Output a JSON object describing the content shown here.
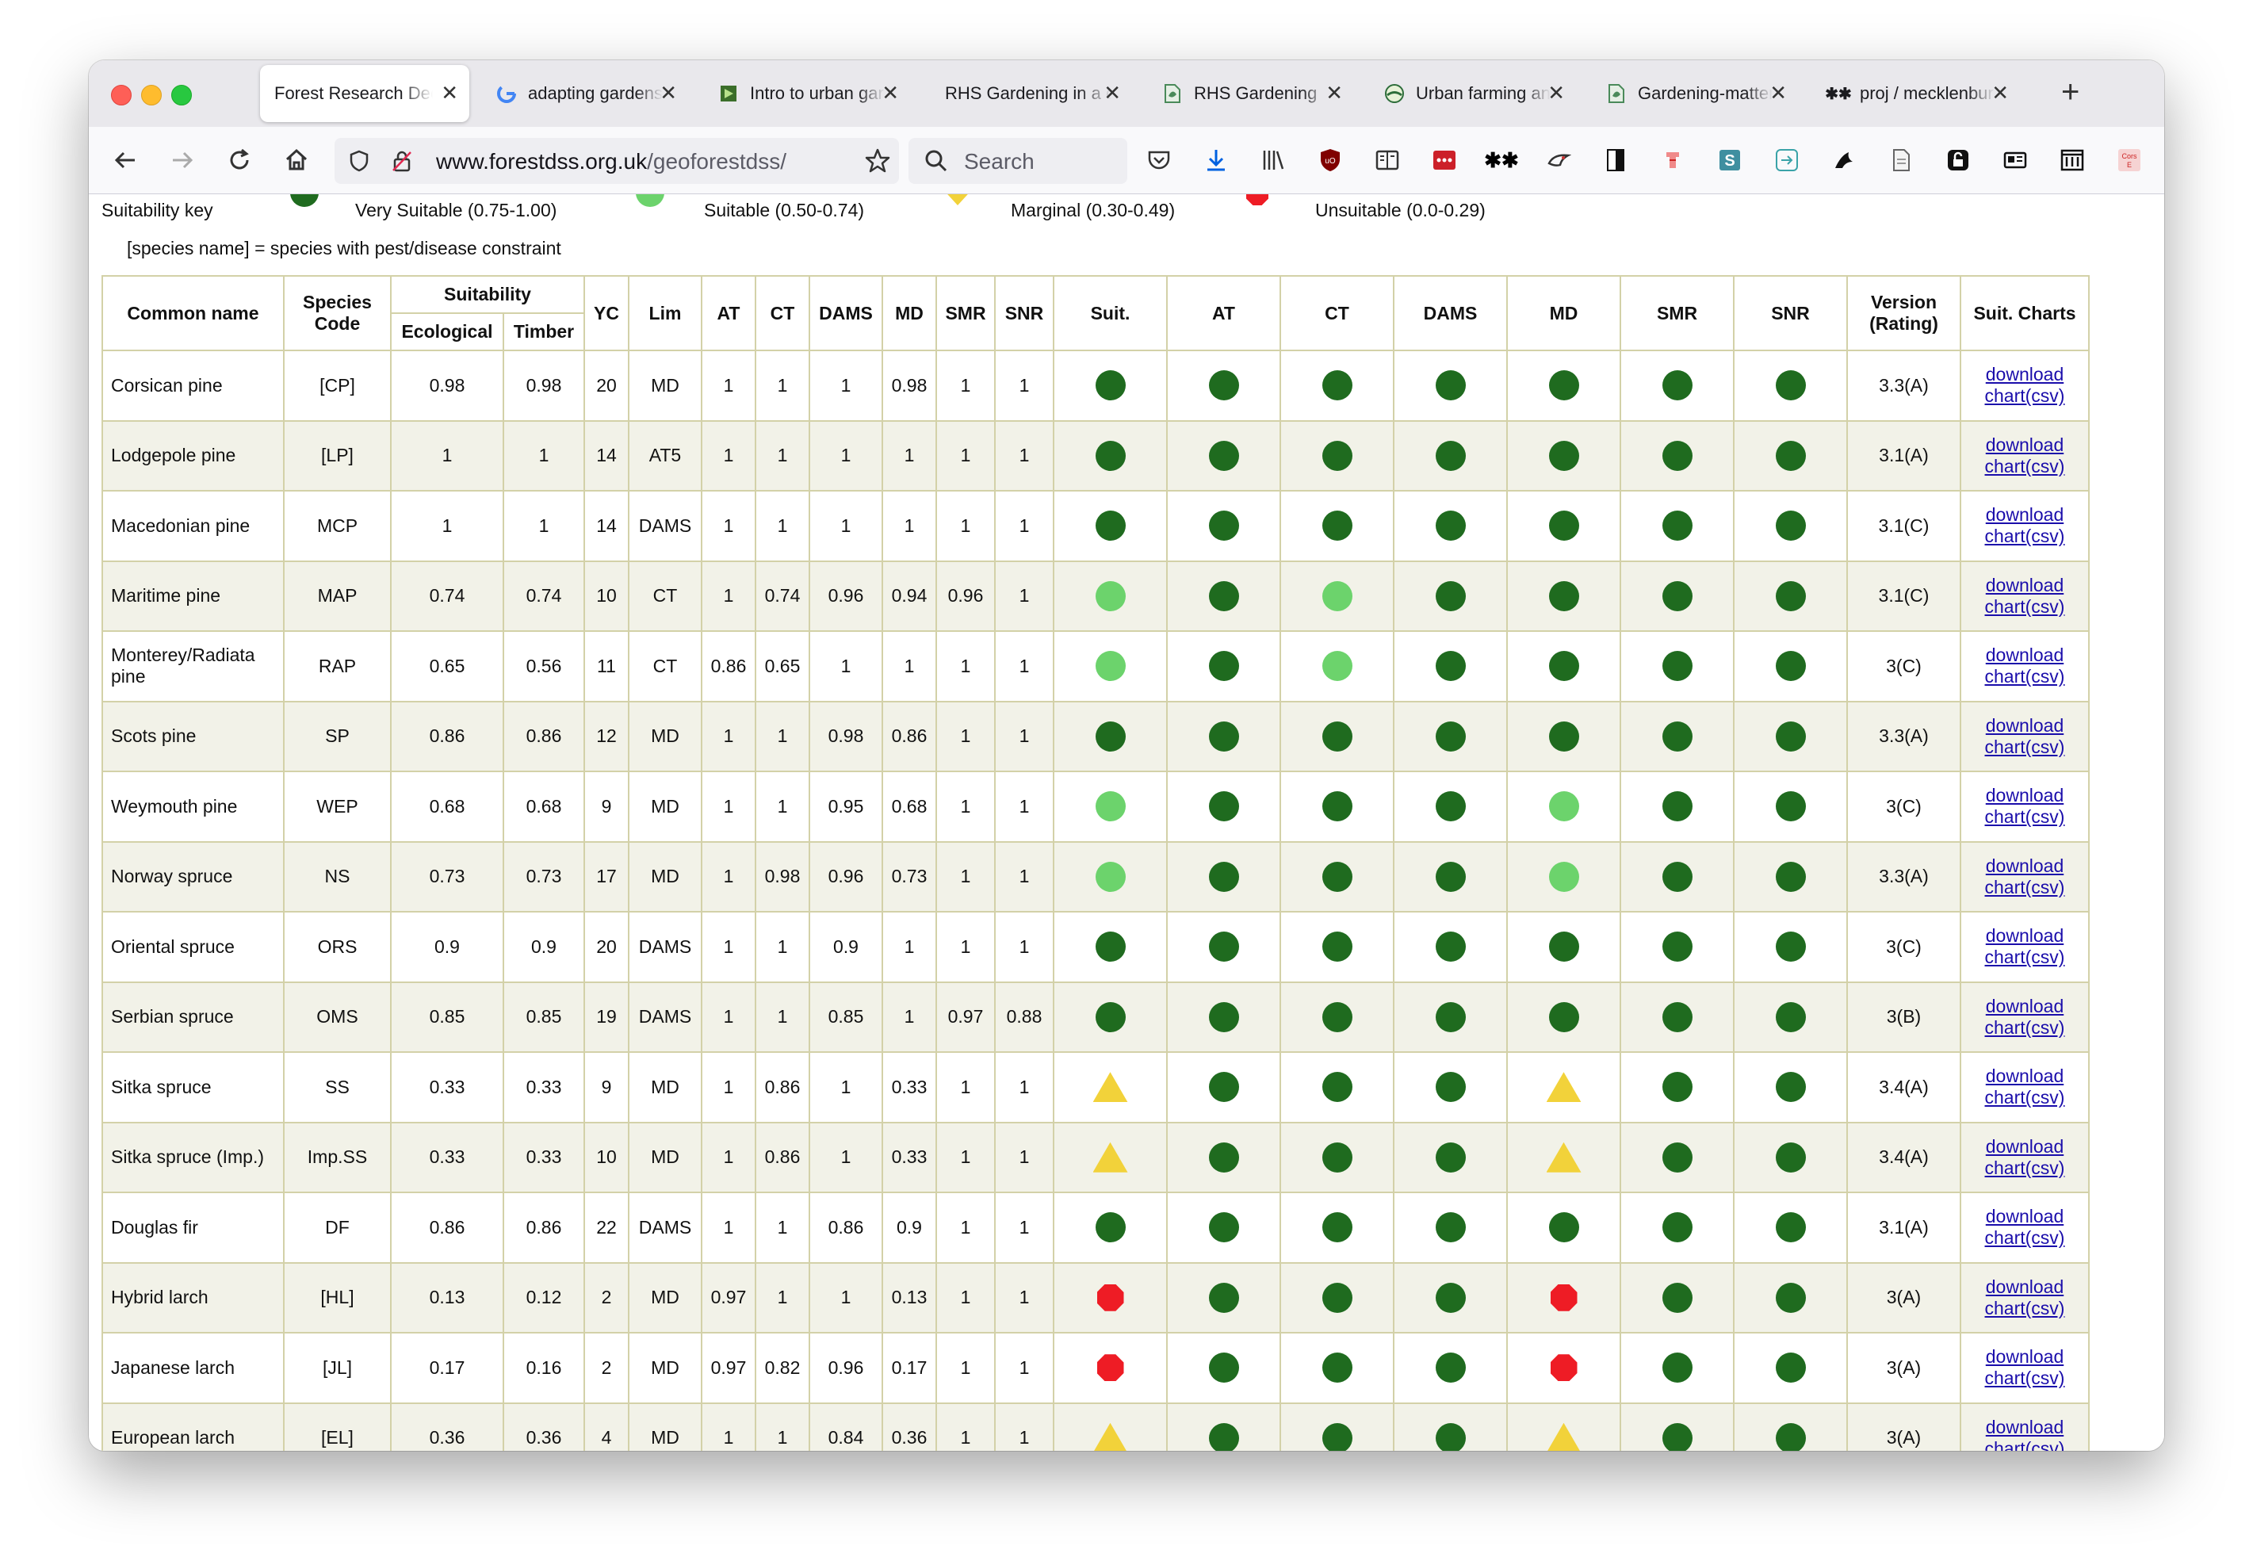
{
  "browser": {
    "tabs": [
      {
        "title": "Forest Research Decision Support",
        "icon": "forest-research-icon",
        "active": true
      },
      {
        "title": "adapting gardens",
        "icon": "google-icon"
      },
      {
        "title": "Intro to urban gardening",
        "icon": "bookmark-flag-icon"
      },
      {
        "title": "RHS Gardening in a changing climate",
        "icon": "none"
      },
      {
        "title": "RHS Gardening",
        "icon": "doc-leaf-icon"
      },
      {
        "title": "Urban farming and",
        "icon": "globe-leaf-icon"
      },
      {
        "title": "Gardening-matters",
        "icon": "doc-leaf-icon"
      },
      {
        "title": "proj / mecklenburg",
        "icon": "asterisk-icon"
      }
    ],
    "url_host": "www.forestdss.org.uk",
    "url_path": "/geoforestdss/",
    "search_placeholder": "Search"
  },
  "page": {
    "key_label": "Suitability key",
    "key_very_suitable": "Very Suitable (0.75-1.00)",
    "key_suitable": "Suitable (0.50-0.74)",
    "key_marginal": "Marginal (0.30-0.49)",
    "key_unsuitable": "Unsuitable (0.0-0.29)",
    "constraint_note": "[species name] = species with pest/disease constraint",
    "headers": {
      "common_name": "Common name",
      "species_code": "Species Code",
      "suitability": "Suitability",
      "ecological": "Ecological",
      "timber": "Timber",
      "yc": "YC",
      "lim": "Lim",
      "at": "AT",
      "ct": "CT",
      "dams": "DAMS",
      "md": "MD",
      "smr": "SMR",
      "snr": "SNR",
      "suit": "Suit.",
      "at2": "AT",
      "ct2": "CT",
      "dams2": "DAMS",
      "md2": "MD",
      "smr2": "SMR",
      "snr2": "SNR",
      "version": "Version (Rating)",
      "suit_charts": "Suit. Charts"
    },
    "download_label": "download",
    "chart_csv_label": "chart(csv)",
    "colors": {
      "very_suitable": "#1f6b1f",
      "suitable": "#6cd36c",
      "marginal": "#f2d23a",
      "unsuitable": "#ee1c25",
      "grid": "#d3d1a8",
      "alt_row": "#f2f2e8",
      "link": "#1a0dab"
    },
    "rows": [
      {
        "name": "Corsican pine",
        "code": "[CP]",
        "eco": "0.98",
        "timber": "0.98",
        "yc": "20",
        "lim": "MD",
        "at": "1",
        "ct": "1",
        "dams": "1",
        "md": "0.98",
        "smr": "1",
        "snr": "1",
        "version": "3.3(A)",
        "icons": [
          "vs",
          "vs",
          "vs",
          "vs",
          "vs",
          "vs",
          "vs"
        ]
      },
      {
        "name": "Lodgepole pine",
        "code": "[LP]",
        "eco": "1",
        "timber": "1",
        "yc": "14",
        "lim": "AT5",
        "at": "1",
        "ct": "1",
        "dams": "1",
        "md": "1",
        "smr": "1",
        "snr": "1",
        "version": "3.1(A)",
        "icons": [
          "vs",
          "vs",
          "vs",
          "vs",
          "vs",
          "vs",
          "vs"
        ]
      },
      {
        "name": "Macedonian pine",
        "code": "MCP",
        "eco": "1",
        "timber": "1",
        "yc": "14",
        "lim": "DAMS",
        "at": "1",
        "ct": "1",
        "dams": "1",
        "md": "1",
        "smr": "1",
        "snr": "1",
        "version": "3.1(C)",
        "icons": [
          "vs",
          "vs",
          "vs",
          "vs",
          "vs",
          "vs",
          "vs"
        ]
      },
      {
        "name": "Maritime pine",
        "code": "MAP",
        "eco": "0.74",
        "timber": "0.74",
        "yc": "10",
        "lim": "CT",
        "at": "1",
        "ct": "0.74",
        "dams": "0.96",
        "md": "0.94",
        "smr": "0.96",
        "snr": "1",
        "version": "3.1(C)",
        "icons": [
          "s",
          "vs",
          "s",
          "vs",
          "vs",
          "vs",
          "vs"
        ]
      },
      {
        "name": "Monterey/Radiata pine",
        "code": "RAP",
        "eco": "0.65",
        "timber": "0.56",
        "yc": "11",
        "lim": "CT",
        "at": "0.86",
        "ct": "0.65",
        "dams": "1",
        "md": "1",
        "smr": "1",
        "snr": "1",
        "version": "3(C)",
        "icons": [
          "s",
          "vs",
          "s",
          "vs",
          "vs",
          "vs",
          "vs"
        ]
      },
      {
        "name": "Scots pine",
        "code": "SP",
        "eco": "0.86",
        "timber": "0.86",
        "yc": "12",
        "lim": "MD",
        "at": "1",
        "ct": "1",
        "dams": "0.98",
        "md": "0.86",
        "smr": "1",
        "snr": "1",
        "version": "3.3(A)",
        "icons": [
          "vs",
          "vs",
          "vs",
          "vs",
          "vs",
          "vs",
          "vs"
        ]
      },
      {
        "name": "Weymouth pine",
        "code": "WEP",
        "eco": "0.68",
        "timber": "0.68",
        "yc": "9",
        "lim": "MD",
        "at": "1",
        "ct": "1",
        "dams": "0.95",
        "md": "0.68",
        "smr": "1",
        "snr": "1",
        "version": "3(C)",
        "icons": [
          "s",
          "vs",
          "vs",
          "vs",
          "s",
          "vs",
          "vs"
        ]
      },
      {
        "name": "Norway spruce",
        "code": "NS",
        "eco": "0.73",
        "timber": "0.73",
        "yc": "17",
        "lim": "MD",
        "at": "1",
        "ct": "0.98",
        "dams": "0.96",
        "md": "0.73",
        "smr": "1",
        "snr": "1",
        "version": "3.3(A)",
        "icons": [
          "s",
          "vs",
          "vs",
          "vs",
          "s",
          "vs",
          "vs"
        ]
      },
      {
        "name": "Oriental spruce",
        "code": "ORS",
        "eco": "0.9",
        "timber": "0.9",
        "yc": "20",
        "lim": "DAMS",
        "at": "1",
        "ct": "1",
        "dams": "0.9",
        "md": "1",
        "smr": "1",
        "snr": "1",
        "version": "3(C)",
        "icons": [
          "vs",
          "vs",
          "vs",
          "vs",
          "vs",
          "vs",
          "vs"
        ]
      },
      {
        "name": "Serbian spruce",
        "code": "OMS",
        "eco": "0.85",
        "timber": "0.85",
        "yc": "19",
        "lim": "DAMS",
        "at": "1",
        "ct": "1",
        "dams": "0.85",
        "md": "1",
        "smr": "0.97",
        "snr": "0.88",
        "version": "3(B)",
        "icons": [
          "vs",
          "vs",
          "vs",
          "vs",
          "vs",
          "vs",
          "vs"
        ]
      },
      {
        "name": "Sitka spruce",
        "code": "SS",
        "eco": "0.33",
        "timber": "0.33",
        "yc": "9",
        "lim": "MD",
        "at": "1",
        "ct": "0.86",
        "dams": "1",
        "md": "0.33",
        "smr": "1",
        "snr": "1",
        "version": "3.4(A)",
        "icons": [
          "m",
          "vs",
          "vs",
          "vs",
          "m",
          "vs",
          "vs"
        ]
      },
      {
        "name": "Sitka spruce (Imp.)",
        "code": "Imp.SS",
        "eco": "0.33",
        "timber": "0.33",
        "yc": "10",
        "lim": "MD",
        "at": "1",
        "ct": "0.86",
        "dams": "1",
        "md": "0.33",
        "smr": "1",
        "snr": "1",
        "version": "3.4(A)",
        "icons": [
          "m",
          "vs",
          "vs",
          "vs",
          "m",
          "vs",
          "vs"
        ]
      },
      {
        "name": "Douglas fir",
        "code": "DF",
        "eco": "0.86",
        "timber": "0.86",
        "yc": "22",
        "lim": "DAMS",
        "at": "1",
        "ct": "1",
        "dams": "0.86",
        "md": "0.9",
        "smr": "1",
        "snr": "1",
        "version": "3.1(A)",
        "icons": [
          "vs",
          "vs",
          "vs",
          "vs",
          "vs",
          "vs",
          "vs"
        ]
      },
      {
        "name": "Hybrid larch",
        "code": "[HL]",
        "eco": "0.13",
        "timber": "0.12",
        "yc": "2",
        "lim": "MD",
        "at": "0.97",
        "ct": "1",
        "dams": "1",
        "md": "0.13",
        "smr": "1",
        "snr": "1",
        "version": "3(A)",
        "icons": [
          "u",
          "vs",
          "vs",
          "vs",
          "u",
          "vs",
          "vs"
        ]
      },
      {
        "name": "Japanese larch",
        "code": "[JL]",
        "eco": "0.17",
        "timber": "0.16",
        "yc": "2",
        "lim": "MD",
        "at": "0.97",
        "ct": "0.82",
        "dams": "0.96",
        "md": "0.17",
        "smr": "1",
        "snr": "1",
        "version": "3(A)",
        "icons": [
          "u",
          "vs",
          "vs",
          "vs",
          "u",
          "vs",
          "vs"
        ]
      },
      {
        "name": "European larch",
        "code": "[EL]",
        "eco": "0.36",
        "timber": "0.36",
        "yc": "4",
        "lim": "MD",
        "at": "1",
        "ct": "1",
        "dams": "0.84",
        "md": "0.36",
        "smr": "1",
        "snr": "1",
        "version": "3(A)",
        "icons": [
          "m",
          "vs",
          "vs",
          "vs",
          "m",
          "vs",
          "vs"
        ]
      }
    ]
  }
}
